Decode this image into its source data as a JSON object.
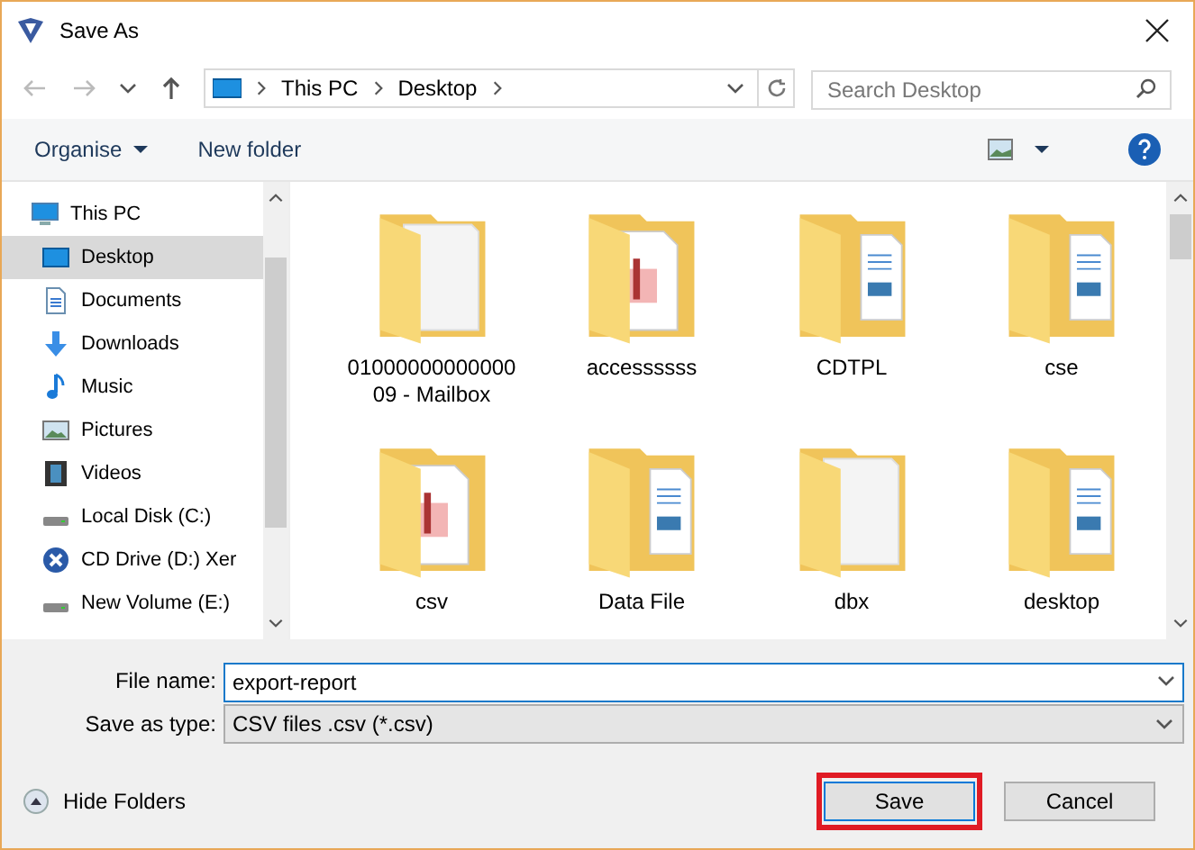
{
  "window": {
    "title": "Save As"
  },
  "address_bar": {
    "crumbs": [
      "This PC",
      "Desktop"
    ]
  },
  "search": {
    "placeholder": "Search Desktop"
  },
  "toolbar": {
    "organise": "Organise",
    "new_folder": "New folder"
  },
  "sidebar": {
    "items": [
      {
        "label": "This PC",
        "kind": "pc",
        "selected": false,
        "children": [
          {
            "label": "Desktop",
            "kind": "desktop",
            "selected": true
          },
          {
            "label": "Documents",
            "kind": "documents",
            "selected": false
          },
          {
            "label": "Downloads",
            "kind": "downloads",
            "selected": false
          },
          {
            "label": "Music",
            "kind": "music",
            "selected": false
          },
          {
            "label": "Pictures",
            "kind": "pictures",
            "selected": false
          },
          {
            "label": "Videos",
            "kind": "videos",
            "selected": false
          },
          {
            "label": "Local Disk (C:)",
            "kind": "disk",
            "selected": false
          },
          {
            "label": "CD Drive (D:) Xer",
            "kind": "cd",
            "selected": false
          },
          {
            "label": "New Volume (E:)",
            "kind": "disk",
            "selected": false
          }
        ]
      }
    ]
  },
  "folders": [
    {
      "name": "0100000000000009 - Mailbox",
      "kind": "blank"
    },
    {
      "name": "accessssss",
      "kind": "pages"
    },
    {
      "name": "CDTPL",
      "kind": "docs"
    },
    {
      "name": "cse",
      "kind": "docs"
    },
    {
      "name": "csv",
      "kind": "pages"
    },
    {
      "name": "Data File",
      "kind": "docs"
    },
    {
      "name": "dbx",
      "kind": "blank"
    },
    {
      "name": "desktop",
      "kind": "docs"
    }
  ],
  "form": {
    "file_name_label": "File name:",
    "file_name": "export-report",
    "type_label": "Save as type:",
    "type": "CSV files .csv (*.csv)"
  },
  "hide_folders": "Hide Folders",
  "buttons": [
    {
      "label": "Save",
      "default": true,
      "highlighted": true
    },
    {
      "label": "Cancel",
      "default": false,
      "highlighted": false
    }
  ]
}
